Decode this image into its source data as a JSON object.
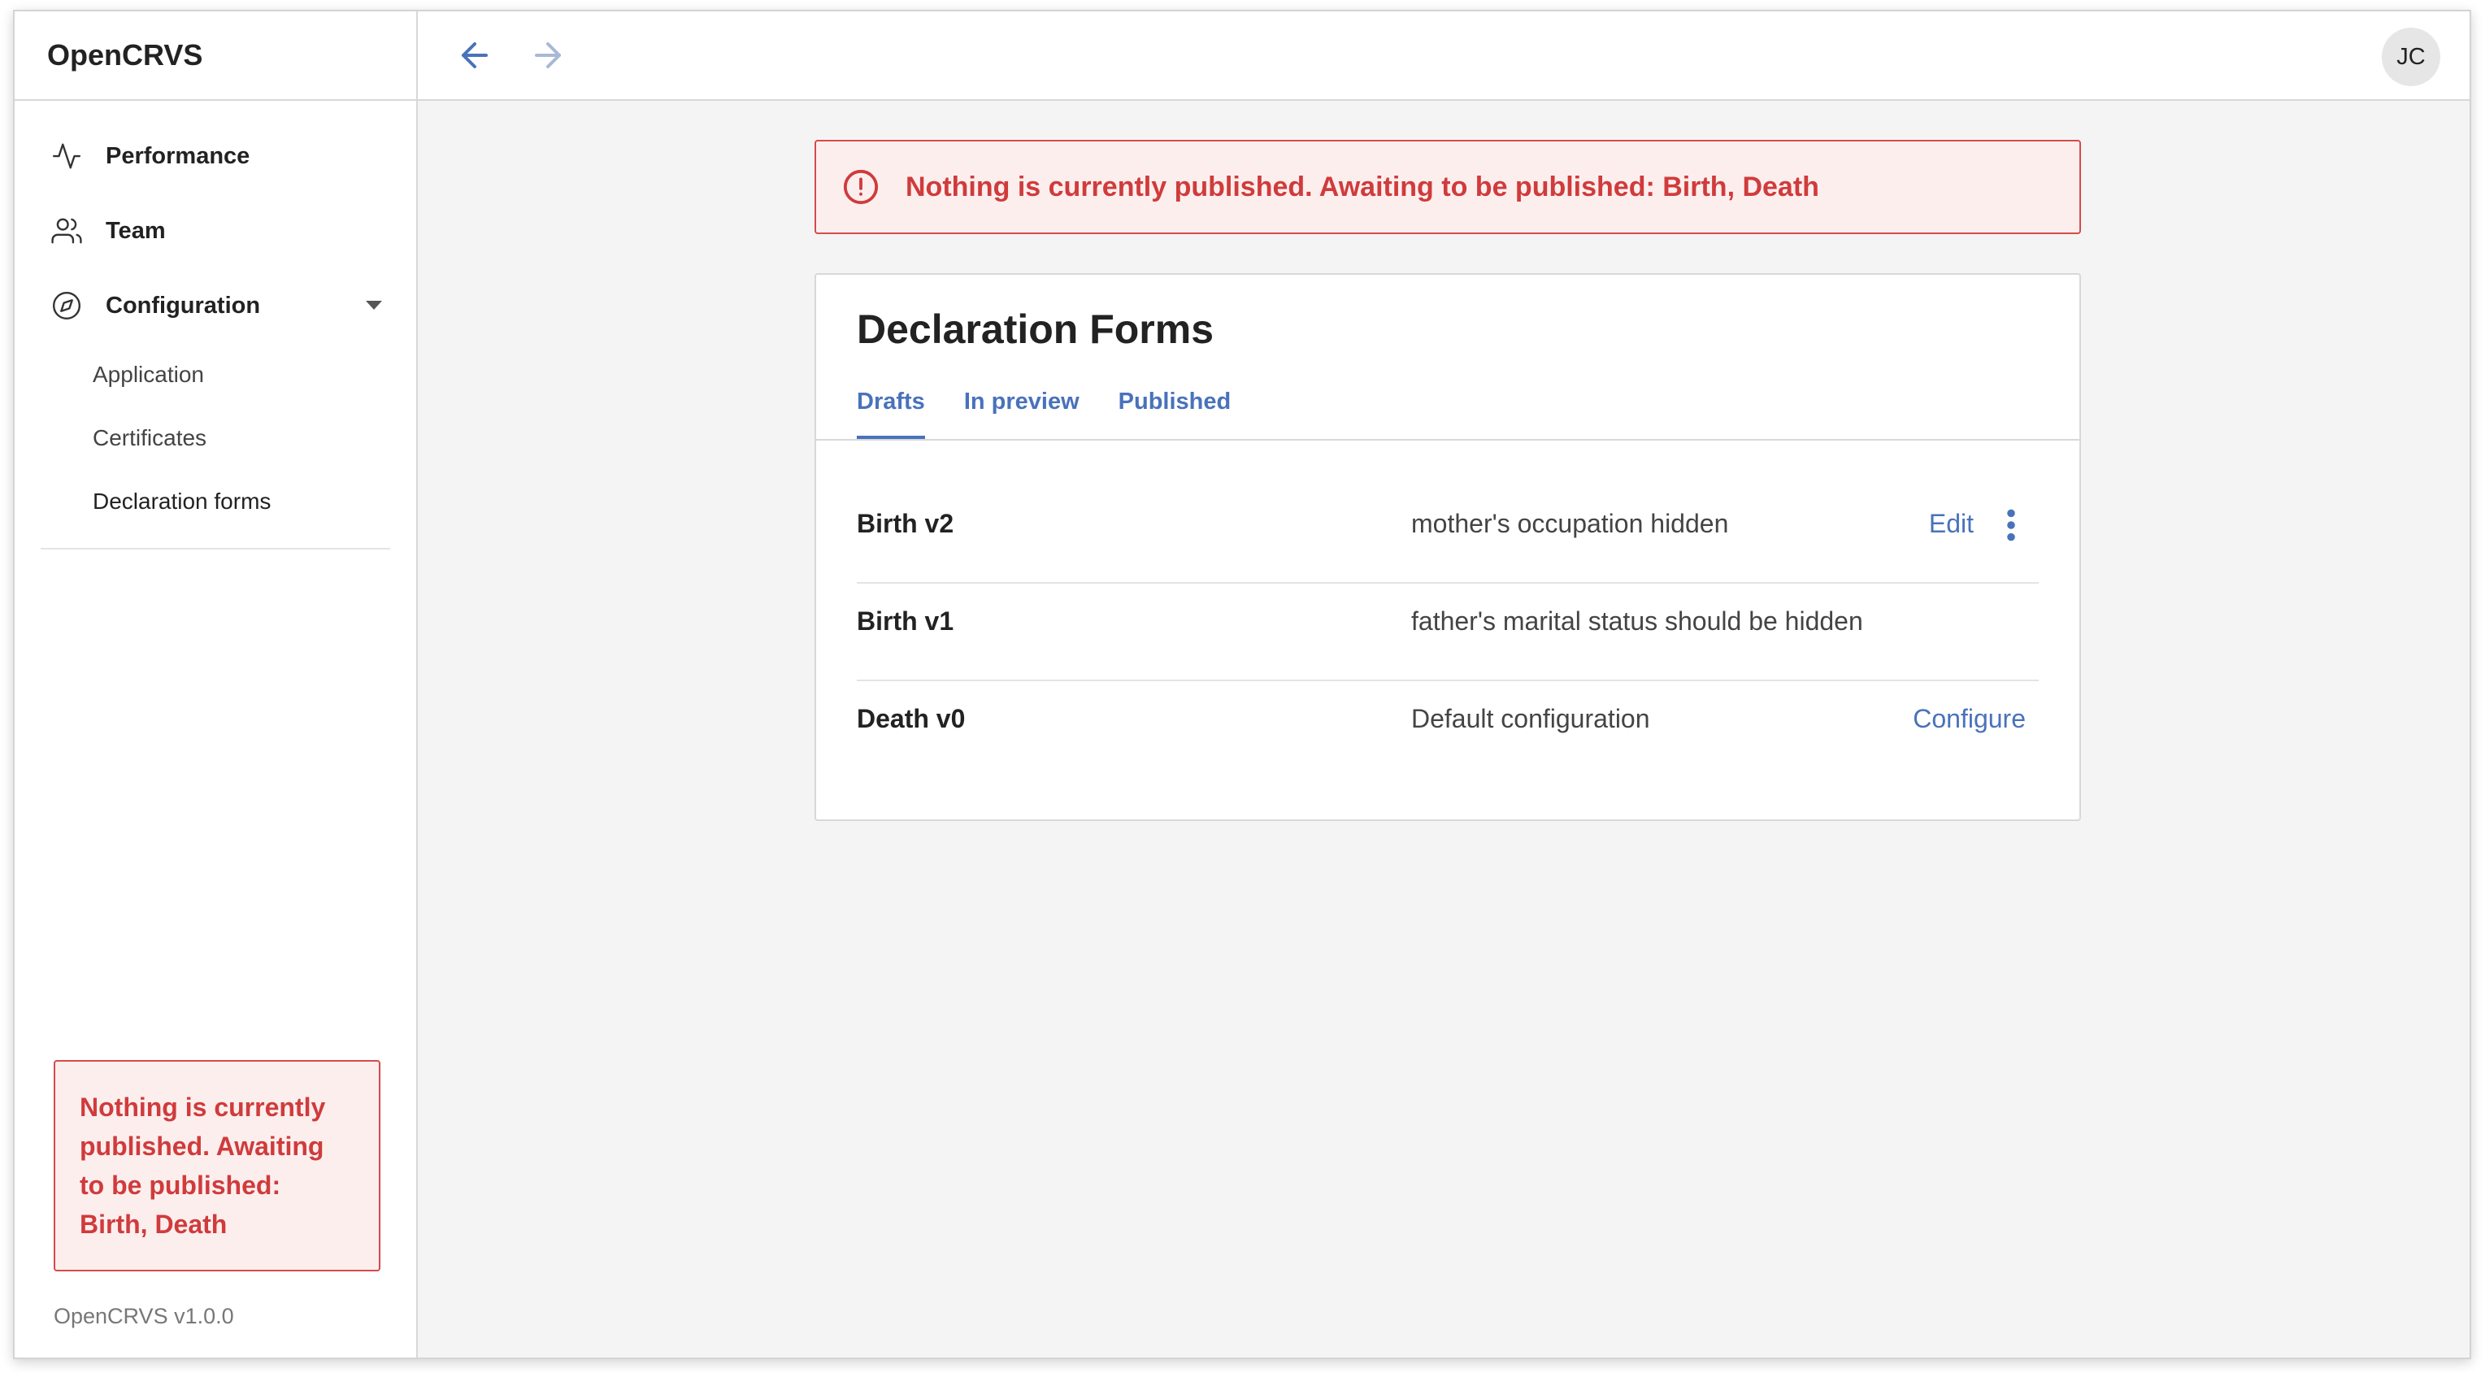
{
  "app": {
    "brand": "OpenCRVS",
    "version": "OpenCRVS v1.0.0"
  },
  "sidebar": {
    "items": [
      {
        "label": "Performance",
        "icon": "activity-icon"
      },
      {
        "label": "Team",
        "icon": "users-icon"
      },
      {
        "label": "Configuration",
        "icon": "compass-icon"
      }
    ],
    "subitems": [
      {
        "label": "Application"
      },
      {
        "label": "Certificates"
      },
      {
        "label": "Declaration forms"
      }
    ],
    "alert": "Nothing is currently published. Awaiting to be published: Birth, Death"
  },
  "topbar": {
    "back_icon": "arrow-left-icon",
    "forward_icon": "arrow-right-icon",
    "avatar_initials": "JC"
  },
  "main": {
    "alert": "Nothing is currently published. Awaiting to be published: Birth, Death",
    "card_title": "Declaration Forms",
    "tabs": [
      {
        "label": "Drafts",
        "active": true
      },
      {
        "label": "In preview"
      },
      {
        "label": "Published"
      }
    ],
    "rows": [
      {
        "name": "Birth v2",
        "comment": "mother's occupation hidden",
        "action": "Edit"
      },
      {
        "name": "Birth v1",
        "comment": "father's marital status should be hidden",
        "action": ""
      },
      {
        "name": "Death v0",
        "comment": "Default configuration",
        "action": "Configure"
      }
    ]
  },
  "colors": {
    "accent": "#4972bb",
    "error": "#d03b3b",
    "error_bg": "#fdeeee",
    "background": "#f4f4f4"
  }
}
